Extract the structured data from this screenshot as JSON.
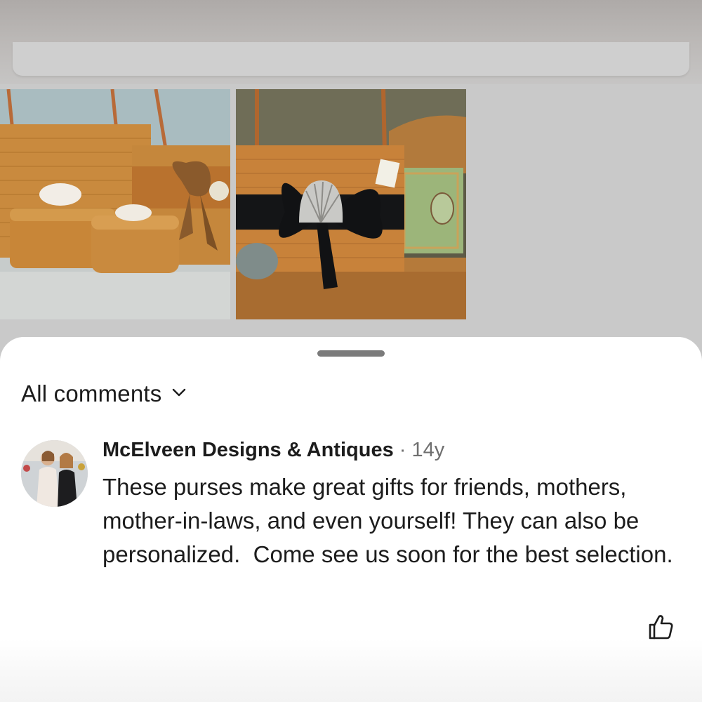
{
  "comments_sheet": {
    "filter_label": "All comments",
    "comment": {
      "author": "McElveen Designs & Antiques",
      "separator": "·",
      "time": "14y",
      "text": "These purses make great gifts for friends, mothers, mother-in-laws, and even yourself! They can also be personalized.  Come see us soon for the best selection."
    }
  },
  "icons": {
    "filter_chevron": "chevron-down-icon",
    "like": "thumbs-up-icon"
  },
  "colors": {
    "sheet_background": "#ffffff",
    "backdrop": "#c9c9c9",
    "text_primary": "#1c1c1c",
    "text_secondary": "#6f6f6f",
    "handle": "#7b7b7b"
  }
}
